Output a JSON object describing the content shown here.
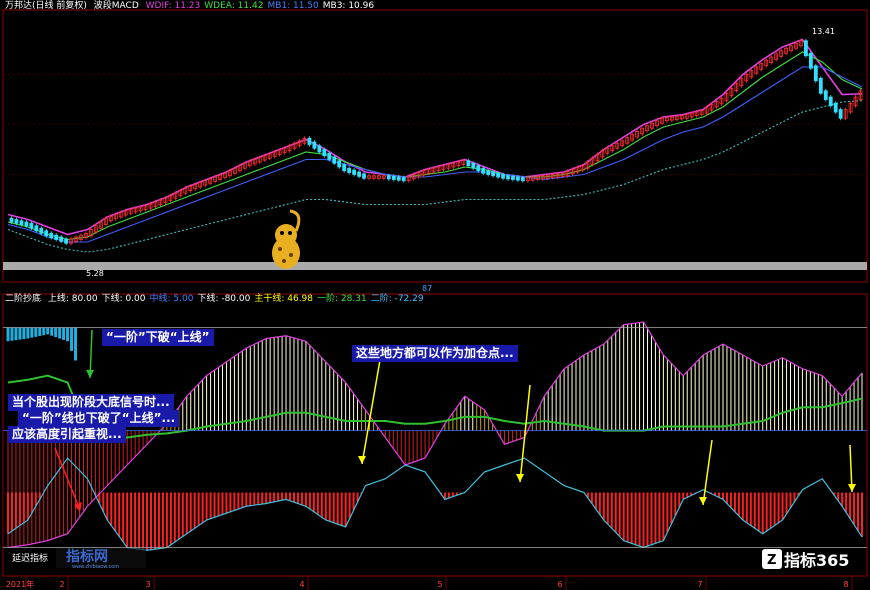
{
  "header_top": {
    "title": "万邦达(日线 前复权)",
    "indicator": "波段MACD",
    "items": [
      {
        "label": "WDIF: 11.23",
        "color": "#e040e0"
      },
      {
        "label": "WDEA: 11.42",
        "color": "#40e040"
      },
      {
        "label": "MB1: 11.50",
        "color": "#4080ff"
      },
      {
        "label": "MB3: 10.96",
        "color": "#ffffff"
      }
    ]
  },
  "header_bottom": {
    "title": "二阶抄底",
    "items": [
      {
        "label": "上线: 80.00",
        "color": "#ffffff"
      },
      {
        "label": "下线: 0.00",
        "color": "#ffffff"
      },
      {
        "label": "中线: 5.00",
        "color": "#4080ff"
      },
      {
        "label": "下线: -80.00",
        "color": "#ffffff"
      },
      {
        "label": "主干线: 46.98",
        "color": "#ffff00"
      },
      {
        "label": "一阶: 28.31",
        "color": "#40e040"
      },
      {
        "label": "二阶: -72.29",
        "color": "#40c0ff"
      }
    ]
  },
  "price_labels": {
    "high": "13.41",
    "low": "5.28"
  },
  "annotations": {
    "first_break": "“一阶”下破“上线”",
    "signal_line1": "当个股出现阶段大底信号时...",
    "signal_line2": "“一阶”线也下破了“上线”...",
    "signal_line3": "应该高度引起重视...",
    "add_positions": "这些地方都可以作为加仓点..."
  },
  "bottom_left_label": "延迟指标",
  "watermark_left": "指标网",
  "watermark_left_url": "www.zhibiaow.com",
  "watermark_right": "指标365",
  "axis_labels": [
    "2021年",
    "2",
    "3",
    "4",
    "5",
    "6",
    "7",
    "8"
  ],
  "mid_marker": "87",
  "chart_data": [
    {
      "type": "line",
      "title": "波段MACD",
      "x": [
        0,
        20,
        40,
        60,
        80,
        100,
        120,
        140,
        160,
        180,
        200,
        220,
        240,
        260,
        280,
        300,
        320,
        340,
        360,
        380,
        400,
        420,
        440,
        460,
        480,
        500,
        520,
        540,
        560,
        580,
        600,
        620,
        640,
        660,
        680,
        700,
        720,
        740,
        760,
        780,
        800,
        820,
        840,
        860
      ],
      "series": [
        {
          "name": "price",
          "values": [
            6.2,
            6.0,
            5.6,
            5.3,
            5.6,
            6.2,
            6.5,
            6.7,
            7.0,
            7.4,
            7.7,
            8.0,
            8.4,
            8.7,
            9.0,
            9.4,
            8.8,
            8.2,
            7.9,
            7.9,
            7.8,
            8.1,
            8.3,
            8.5,
            8.1,
            7.9,
            7.8,
            7.9,
            8.0,
            8.3,
            8.9,
            9.3,
            9.8,
            10.2,
            10.3,
            10.5,
            11.0,
            11.8,
            12.4,
            12.9,
            13.3,
            11.3,
            10.3,
            11.3
          ]
        },
        {
          "name": "WDIF",
          "values": [
            6.4,
            6.2,
            5.9,
            5.6,
            5.8,
            6.3,
            6.6,
            6.8,
            7.1,
            7.5,
            7.8,
            8.1,
            8.5,
            8.8,
            9.1,
            9.4,
            9.0,
            8.5,
            8.1,
            8.0,
            7.9,
            8.2,
            8.4,
            8.6,
            8.3,
            8.0,
            7.9,
            8.0,
            8.1,
            8.4,
            9.0,
            9.5,
            10.0,
            10.3,
            10.4,
            10.6,
            11.2,
            12.0,
            12.6,
            13.1,
            13.4,
            12.3,
            11.2,
            11.23
          ]
        },
        {
          "name": "WDEA",
          "values": [
            6.1,
            5.9,
            5.6,
            5.4,
            5.5,
            5.9,
            6.2,
            6.5,
            6.8,
            7.1,
            7.4,
            7.7,
            8.0,
            8.3,
            8.6,
            8.9,
            8.8,
            8.5,
            8.2,
            8.0,
            7.9,
            8.0,
            8.1,
            8.3,
            8.2,
            8.0,
            7.9,
            7.9,
            8.0,
            8.2,
            8.6,
            9.0,
            9.5,
            9.9,
            10.1,
            10.3,
            10.7,
            11.3,
            11.9,
            12.4,
            12.9,
            12.5,
            11.8,
            11.42
          ]
        },
        {
          "name": "MB1",
          "values": [
            6.0,
            5.8,
            5.5,
            5.3,
            5.3,
            5.6,
            5.9,
            6.2,
            6.5,
            6.8,
            7.1,
            7.4,
            7.7,
            8.0,
            8.3,
            8.6,
            8.6,
            8.4,
            8.2,
            8.0,
            7.9,
            7.9,
            8.0,
            8.1,
            8.1,
            8.0,
            7.9,
            7.8,
            7.9,
            8.0,
            8.3,
            8.6,
            9.0,
            9.4,
            9.7,
            9.9,
            10.3,
            10.8,
            11.3,
            11.8,
            12.3,
            12.3,
            11.9,
            11.5
          ]
        },
        {
          "name": "MB3",
          "values": [
            5.8,
            5.5,
            5.2,
            5.0,
            4.9,
            5.0,
            5.2,
            5.4,
            5.6,
            5.8,
            6.0,
            6.2,
            6.4,
            6.6,
            6.8,
            7.0,
            7.0,
            6.9,
            6.8,
            6.8,
            6.8,
            6.8,
            6.9,
            7.0,
            7.0,
            7.0,
            7.0,
            7.0,
            7.1,
            7.2,
            7.4,
            7.6,
            7.9,
            8.2,
            8.4,
            8.6,
            8.9,
            9.3,
            9.7,
            10.1,
            10.5,
            10.7,
            10.9,
            10.96
          ]
        }
      ],
      "ylim": [
        4.5,
        14.5
      ]
    },
    {
      "type": "bar",
      "title": "二阶抄底",
      "x": [
        0,
        20,
        40,
        60,
        80,
        100,
        120,
        140,
        160,
        180,
        200,
        220,
        240,
        260,
        280,
        300,
        320,
        340,
        360,
        380,
        400,
        420,
        440,
        460,
        480,
        500,
        520,
        540,
        560,
        580,
        600,
        620,
        640,
        660,
        680,
        700,
        720,
        740,
        760,
        780,
        800,
        820,
        840,
        860
      ],
      "series": [
        {
          "name": "主干线",
          "values": [
            -80,
            -78,
            -75,
            -70,
            -50,
            -35,
            -20,
            -5,
            10,
            30,
            45,
            55,
            65,
            72,
            74,
            70,
            55,
            40,
            20,
            0,
            -20,
            -15,
            10,
            30,
            20,
            -5,
            0,
            30,
            50,
            60,
            68,
            82,
            84,
            60,
            45,
            60,
            68,
            60,
            52,
            58,
            50,
            45,
            30,
            46.98
          ]
        },
        {
          "name": "一阶",
          "values": [
            40,
            42,
            45,
            40,
            5,
            -2,
            0,
            2,
            3,
            5,
            8,
            10,
            12,
            15,
            18,
            18,
            15,
            12,
            12,
            12,
            10,
            10,
            12,
            15,
            15,
            12,
            10,
            12,
            10,
            8,
            5,
            5,
            5,
            8,
            8,
            8,
            8,
            10,
            12,
            18,
            22,
            22,
            25,
            28.31
          ]
        },
        {
          "name": "二阶",
          "values": [
            -70,
            -60,
            -35,
            -15,
            -30,
            -60,
            -80,
            -82,
            -80,
            -70,
            -60,
            -55,
            -50,
            -48,
            -45,
            -50,
            -60,
            -65,
            -35,
            -30,
            -20,
            -25,
            -45,
            -40,
            -25,
            -20,
            -15,
            -25,
            -35,
            -40,
            -60,
            -75,
            -80,
            -75,
            -45,
            -38,
            -45,
            -60,
            -70,
            -60,
            -38,
            -30,
            -50,
            -72.29
          ]
        }
      ],
      "lines": {
        "上线": 80,
        "中线": 5,
        "下线": -80
      }
    }
  ]
}
